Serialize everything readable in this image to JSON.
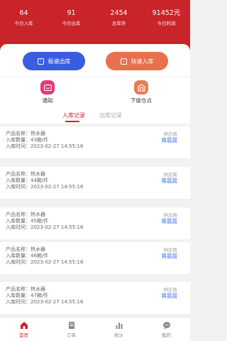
{
  "stats": [
    {
      "value": "64",
      "label": "今日入库"
    },
    {
      "value": "91",
      "label": "今日出库"
    },
    {
      "value": "2454",
      "label": "总库存"
    },
    {
      "value": "91452元",
      "label": "今日利润"
    }
  ],
  "actions": {
    "out_label": "极速出库",
    "in_label": "快速入库"
  },
  "shortcuts": {
    "notify_label": "通知",
    "sub_label": "下级仓点"
  },
  "tabs": {
    "in_label": "入库记录",
    "out_label": "出库记录"
  },
  "records": [
    {
      "name": "产品名称：热水器",
      "qty": "入库数量：43箱/件",
      "time": "入库时间：2023-02-27 14:55:18",
      "supplier_label": "供应商",
      "supplier": "蒋晨晨"
    },
    {
      "name": "产品名称：热水器",
      "qty": "入库数量：44箱/件",
      "time": "入库时间：2023-02-27 14:55:18",
      "supplier_label": "供应商",
      "supplier": "蒋晨晨"
    },
    {
      "name": "产品名称：热水器",
      "qty": "入库数量：45箱/件",
      "time": "入库时间：2023-02-27 14:55:18",
      "supplier_label": "供应商",
      "supplier": "蒋晨晨"
    },
    {
      "name": "产品名称：热水器",
      "qty": "入库数量：46箱/件",
      "time": "入库时间：2023-02-27 14:55:18",
      "supplier_label": "供应商",
      "supplier": "蒋晨晨"
    },
    {
      "name": "产品名称：热水器",
      "qty": "入库数量：47箱/件",
      "time": "入库时间：2023-02-27 14:55:18",
      "supplier_label": "供应商",
      "supplier": "蒋晨晨"
    }
  ],
  "nav": [
    {
      "label": "首页",
      "icon": "home-icon",
      "active": true
    },
    {
      "label": "订单",
      "icon": "orders-icon",
      "active": false
    },
    {
      "label": "统计",
      "icon": "stats-icon",
      "active": false
    },
    {
      "label": "我的",
      "icon": "profile-icon",
      "active": false
    }
  ],
  "colors": {
    "brand_red": "#c8242a",
    "out_blue": "#3a5ce0",
    "in_orange": "#e8704e",
    "supplier_blue": "#3a6ee8"
  }
}
